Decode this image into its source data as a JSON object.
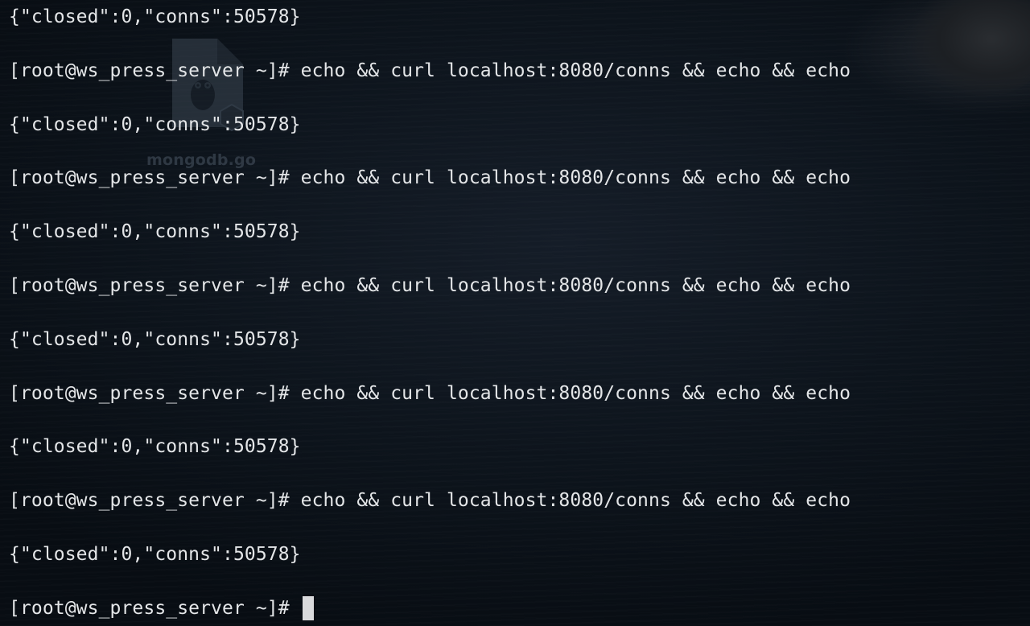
{
  "terminal": {
    "lines": [
      {
        "kind": "output",
        "text": "{\"closed\":0,\"conns\":50578}"
      },
      {
        "kind": "prompt",
        "prompt": "[root@ws_press_server ~]# ",
        "command": "echo && curl localhost:8080/conns && echo && echo"
      },
      {
        "kind": "output",
        "text": "{\"closed\":0,\"conns\":50578}"
      },
      {
        "kind": "prompt",
        "prompt": "[root@ws_press_server ~]# ",
        "command": "echo && curl localhost:8080/conns && echo && echo"
      },
      {
        "kind": "output",
        "text": "{\"closed\":0,\"conns\":50578}"
      },
      {
        "kind": "prompt",
        "prompt": "[root@ws_press_server ~]# ",
        "command": "echo && curl localhost:8080/conns && echo && echo"
      },
      {
        "kind": "output",
        "text": "{\"closed\":0,\"conns\":50578}"
      },
      {
        "kind": "prompt",
        "prompt": "[root@ws_press_server ~]# ",
        "command": "echo && curl localhost:8080/conns && echo && echo"
      },
      {
        "kind": "output",
        "text": "{\"closed\":0,\"conns\":50578}"
      },
      {
        "kind": "prompt",
        "prompt": "[root@ws_press_server ~]# ",
        "command": "echo && curl localhost:8080/conns && echo && echo"
      },
      {
        "kind": "output",
        "text": "{\"closed\":0,\"conns\":50578}"
      },
      {
        "kind": "prompt",
        "prompt": "[root@ws_press_server ~]# ",
        "command": ""
      }
    ],
    "text_color": "#e4e6e8",
    "cursor_color": "#d9dadc"
  },
  "watermark": {
    "text": "mongodb.go",
    "icon": "gopher-file-icon"
  }
}
